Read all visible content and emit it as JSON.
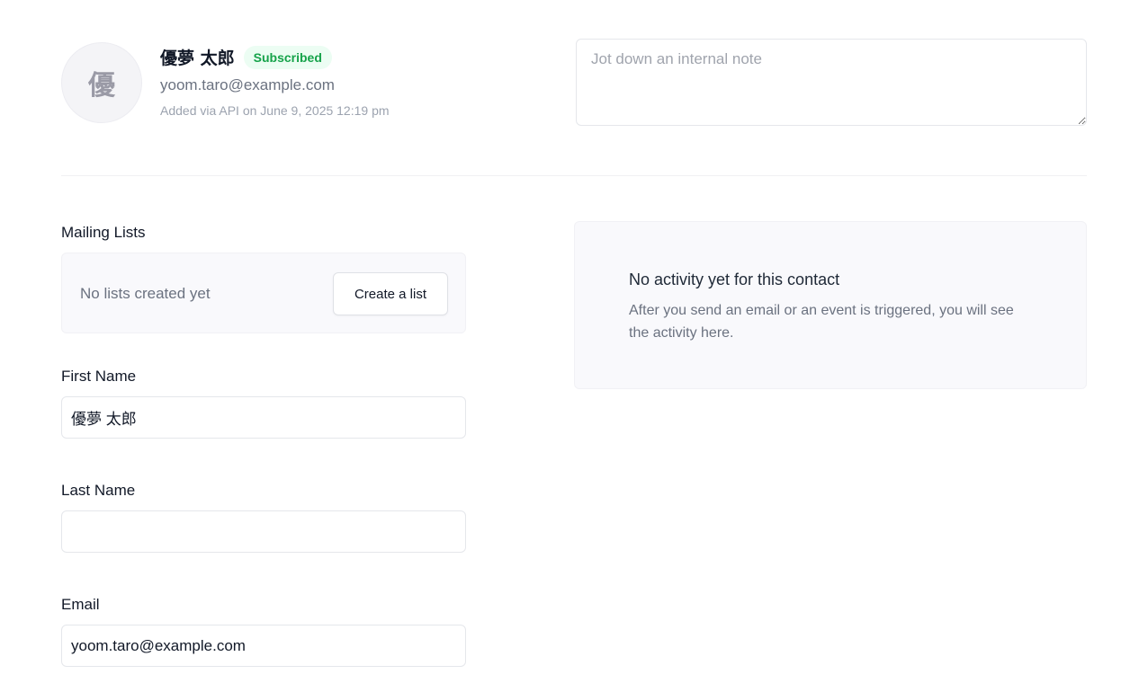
{
  "contact": {
    "avatar_initial": "優",
    "name": "優夢 太郎",
    "status_badge": "Subscribed",
    "email": "yoom.taro@example.com",
    "added_meta": "Added via API on June 9, 2025 12:19 pm"
  },
  "note": {
    "placeholder": "Jot down an internal note",
    "value": ""
  },
  "mailing_lists": {
    "label": "Mailing Lists",
    "empty_text": "No lists created yet",
    "create_button": "Create a list"
  },
  "fields": {
    "first_name": {
      "label": "First Name",
      "value": "優夢 太郎"
    },
    "last_name": {
      "label": "Last Name",
      "value": ""
    },
    "email": {
      "label": "Email",
      "value": "yoom.taro@example.com"
    }
  },
  "activity": {
    "title": "No activity yet for this contact",
    "description": "After you send an email or an event is triggered, you will see the activity here."
  },
  "colors": {
    "badge_text": "#16a34a",
    "badge_bg": "#ecfdf3",
    "panel_bg": "#f9f9fc"
  }
}
